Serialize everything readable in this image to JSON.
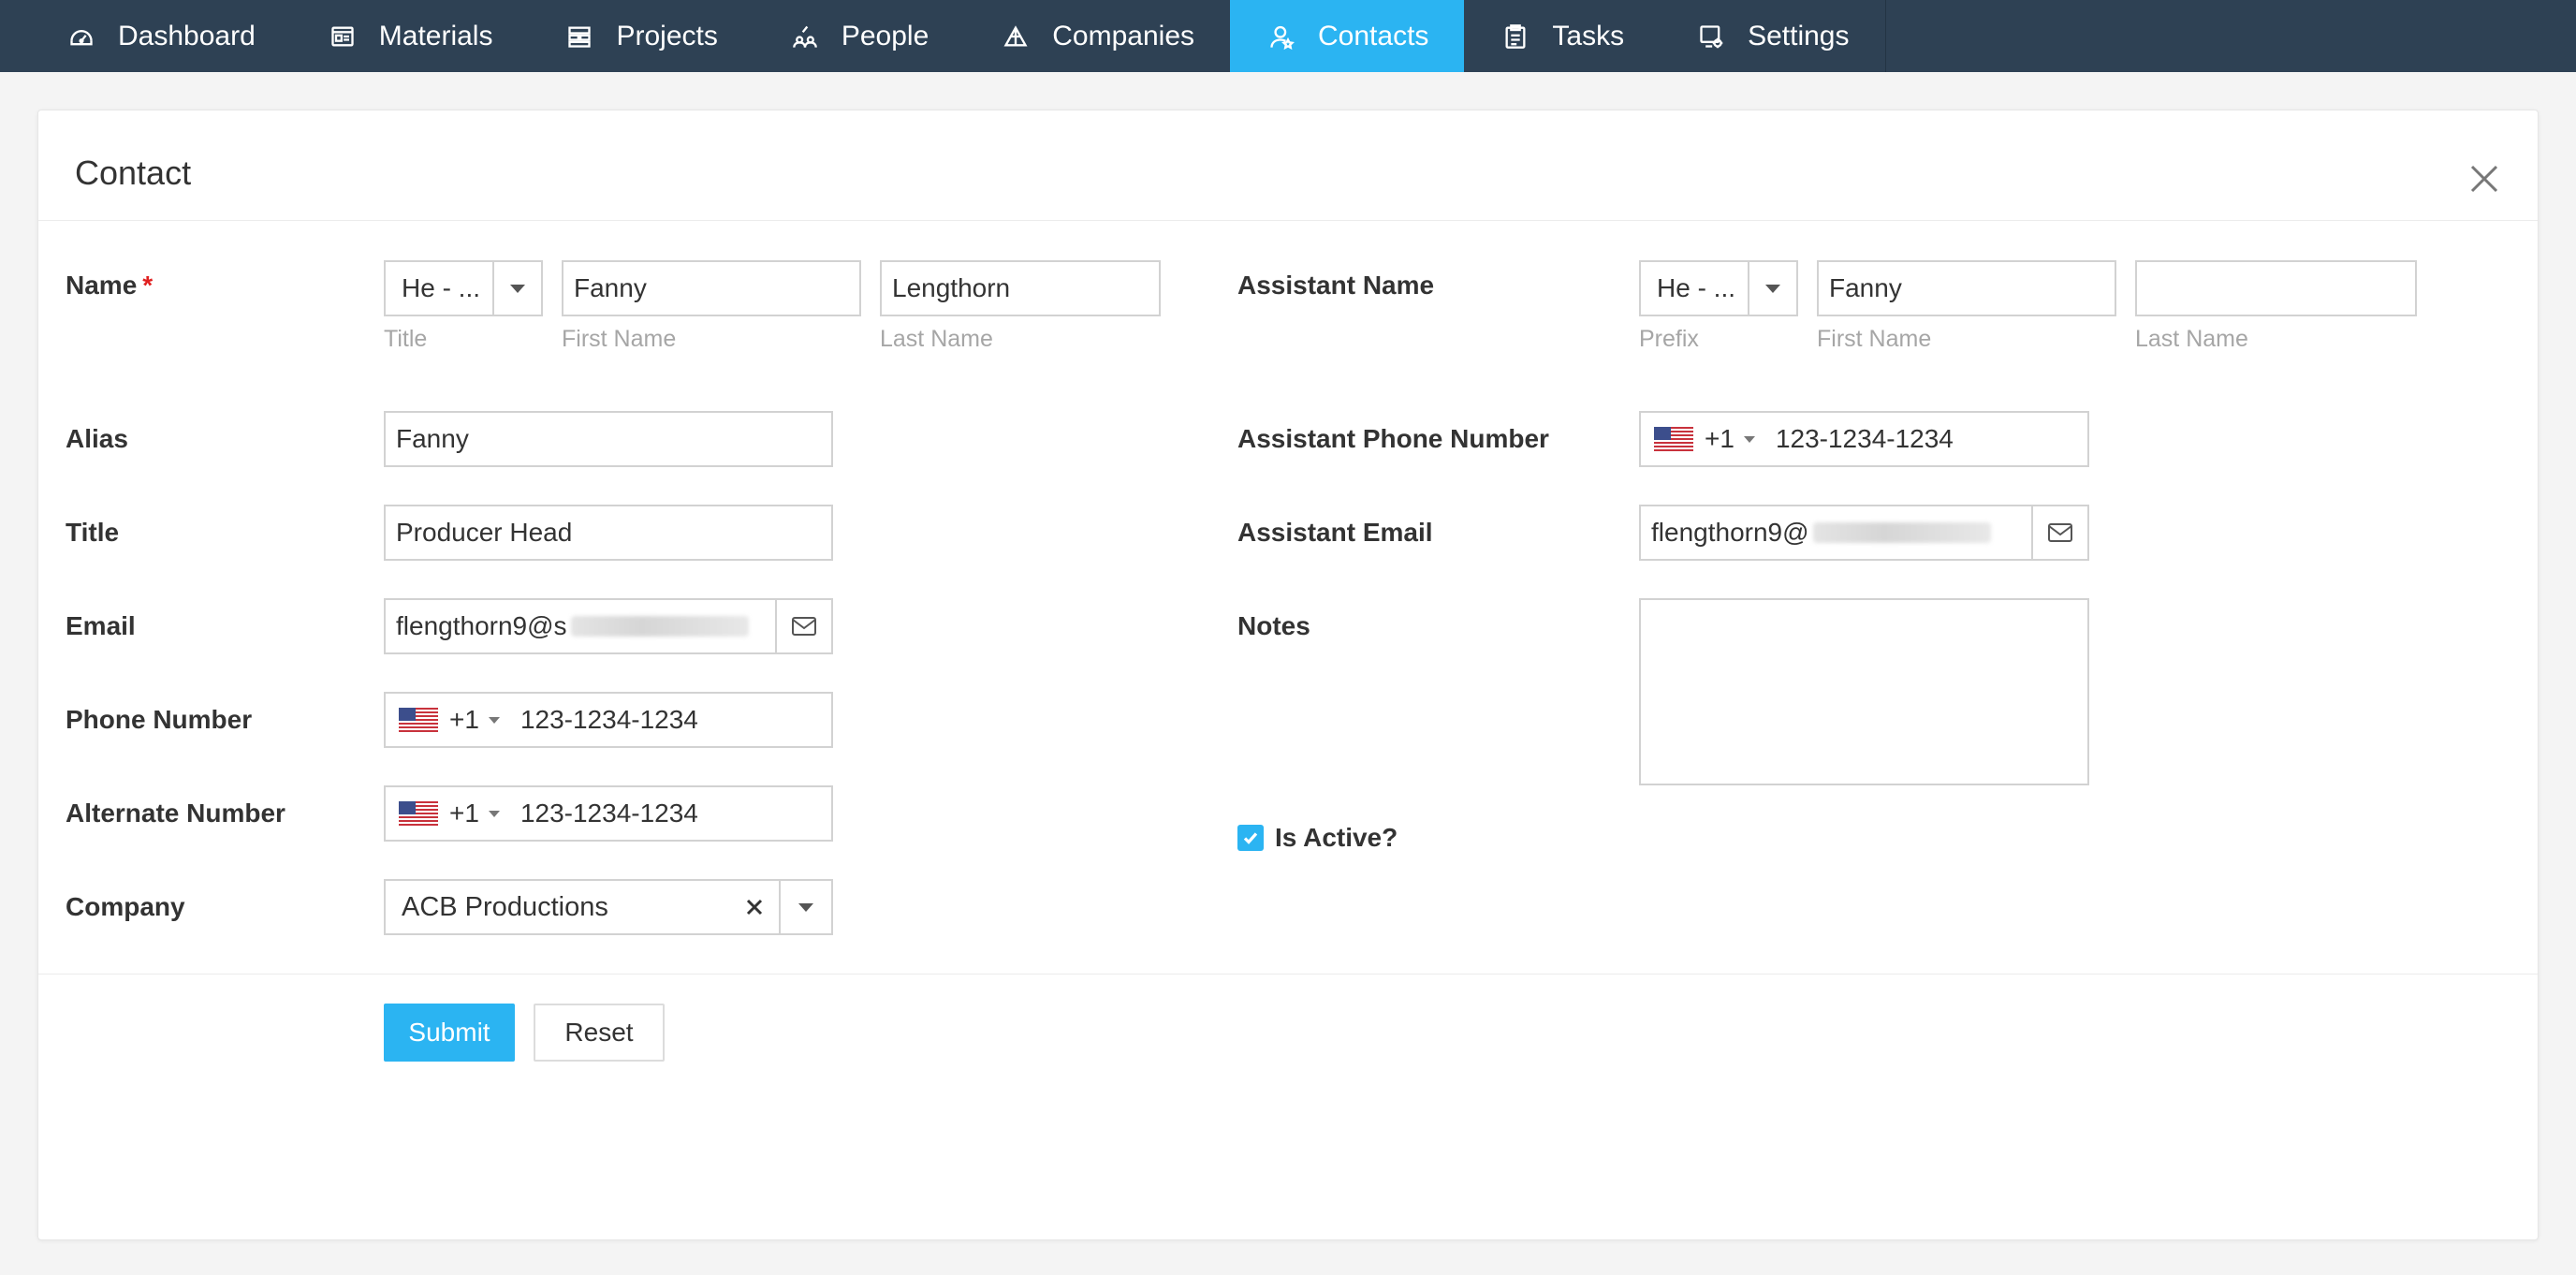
{
  "nav": {
    "items": [
      {
        "label": "Dashboard",
        "icon": "dashboard-icon"
      },
      {
        "label": "Materials",
        "icon": "materials-icon"
      },
      {
        "label": "Projects",
        "icon": "projects-icon"
      },
      {
        "label": "People",
        "icon": "people-icon"
      },
      {
        "label": "Companies",
        "icon": "companies-icon"
      },
      {
        "label": "Contacts",
        "icon": "contacts-icon"
      },
      {
        "label": "Tasks",
        "icon": "tasks-icon"
      },
      {
        "label": "Settings",
        "icon": "settings-icon"
      }
    ],
    "active": "Contacts",
    "active_color": "#2bb4f2",
    "bar_color": "#2e4154"
  },
  "card": {
    "title": "Contact"
  },
  "form": {
    "name": {
      "label": "Name",
      "required_mark": "*",
      "title_value": "He - ...",
      "title_sub": "Title",
      "first_name": "Fanny",
      "first_name_sub": "First Name",
      "last_name": "Lengthorn",
      "last_name_sub": "Last Name"
    },
    "alias": {
      "label": "Alias",
      "value": "Fanny"
    },
    "title": {
      "label": "Title",
      "value": "Producer Head"
    },
    "email": {
      "label": "Email",
      "value": "flengthorn9@s"
    },
    "phone": {
      "label": "Phone Number",
      "dial": "+1",
      "value": "123-1234-1234"
    },
    "alternate": {
      "label": "Alternate Number",
      "dial": "+1",
      "value": "123-1234-1234"
    },
    "company": {
      "label": "Company",
      "value": "ACB Productions"
    },
    "assistant_name": {
      "label": "Assistant Name",
      "prefix_value": "He - ...",
      "prefix_sub": "Prefix",
      "first_name": "Fanny",
      "first_name_sub": "First Name",
      "last_name": "",
      "last_name_sub": "Last Name"
    },
    "assistant_phone": {
      "label": "Assistant Phone Number",
      "dial": "+1",
      "value": "123-1234-1234"
    },
    "assistant_email": {
      "label": "Assistant Email",
      "value": "flengthorn9@"
    },
    "notes": {
      "label": "Notes",
      "value": ""
    },
    "is_active": {
      "label": "Is Active?",
      "checked": true
    }
  },
  "actions": {
    "submit": "Submit",
    "reset": "Reset"
  }
}
